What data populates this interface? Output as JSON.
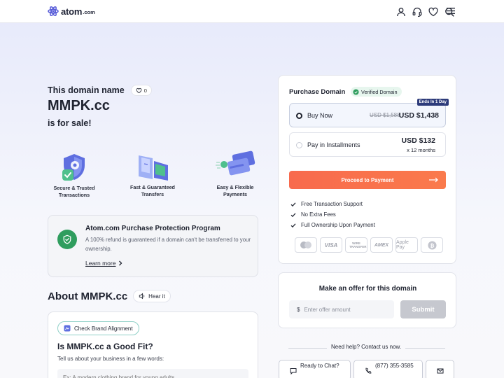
{
  "brand": {
    "name": "atom",
    "tld": ".com",
    "accent": "#5b5fd9"
  },
  "header": {
    "icons": [
      "user-icon",
      "headset-icon",
      "heart-icon",
      "search-icon",
      "menu-icon"
    ]
  },
  "hero": {
    "eyebrow": "This domain name",
    "like_count": "0",
    "domain": "MMPK.cc",
    "status": "is for sale!"
  },
  "features": [
    {
      "label_1": "Secure & Trusted",
      "label_2": "Transactions",
      "icon": "shield-check-icon"
    },
    {
      "label_1": "Fast & Guaranteed",
      "label_2": "Transfers",
      "icon": "transfer-icon"
    },
    {
      "label_1": "Easy & Flexible",
      "label_2": "Payments",
      "icon": "cards-icon"
    }
  ],
  "protection": {
    "title": "Atom.com Purchase Protection Program",
    "text": "A 100% refund is guaranteed if a domain can't be transferred to your ownership.",
    "link": "Learn more"
  },
  "about": {
    "title": "About MMPK.cc",
    "hear_label": "Hear it"
  },
  "fit": {
    "pill": "Check Brand Alignment",
    "title": "Is MMPK.cc a Good Fit?",
    "subtitle": "Tell us about your business in a few words:",
    "placeholder": "Ex: A modern clothing brand for young adults"
  },
  "purchase": {
    "title": "Purchase Domain",
    "verified": "Verified Domain",
    "badge": "Ends In 1 Day",
    "buy_now": {
      "label": "Buy Now",
      "old_price": "USD $1,588",
      "price": "USD $1,438",
      "selected": true
    },
    "installments": {
      "label": "Pay in Installments",
      "price": "USD $132",
      "months": "x 12 months",
      "selected": false
    },
    "cta": "Proceed to Payment",
    "benefits": [
      "Free Transaction Support",
      "No Extra Fees",
      "Full Ownership Upon Payment"
    ],
    "payment_methods": [
      "mastercard-icon",
      "VISA",
      "WIRE TRANSFER",
      "AMEX",
      "Apple Pay",
      "bitcoin-icon"
    ],
    "cta_color": "#f86a4d",
    "verified_color": "#2f9d5e"
  },
  "offer": {
    "title": "Make an offer for this domain",
    "currency": "$",
    "placeholder": "Enter offer amount",
    "submit": "Submit"
  },
  "help": {
    "text": "Need help? Contact us now.",
    "chat": "Ready to Chat?",
    "phone": "(877) 355-3585"
  }
}
